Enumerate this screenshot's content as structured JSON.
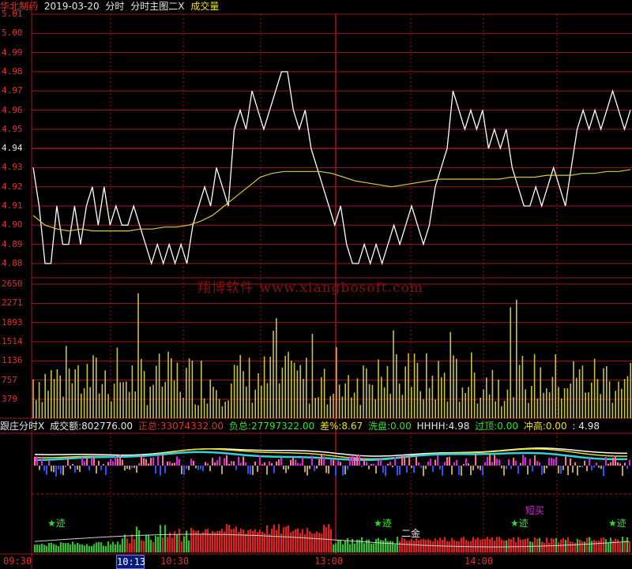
{
  "header": {
    "stock_name": "华北制药",
    "date": "2019-03-20",
    "period": "分时",
    "main_indicator": "分时主图二X",
    "volume_label": "成交量"
  },
  "indicator_bar": {
    "name": "跟庄分时X",
    "turnover_label": "成交额:",
    "turnover_value": "802776.00",
    "positive_label": "正总:",
    "positive_value": "33074332.00",
    "negative_label": "负总:",
    "negative_value": "27797322.00",
    "diff_label": "差%:",
    "diff_value": "8.67",
    "wash_label": "洗盘:",
    "wash_value": "0.00",
    "hhhh_label": "HHHH:",
    "hhhh_value": "4.98",
    "top_label": "过顶:",
    "top_value": "0.00",
    "rush_label": "冲高:",
    "rush_value": "0.00",
    "last_value": ": 4.98"
  },
  "price_axis": [
    "5.01",
    "5.00",
    "4.99",
    "4.98",
    "4.97",
    "4.96",
    "4.95",
    "4.94",
    "4.93",
    "4.92",
    "4.91",
    "4.90",
    "4.89",
    "4.88"
  ],
  "volume_axis": [
    "2650",
    "2271",
    "1893",
    "1514",
    "1136",
    "757",
    "379"
  ],
  "time_axis": [
    "09:30",
    "10:30",
    "13:00",
    "14:00"
  ],
  "selected_time": "10:13",
  "watermark": "翔博软件 www.xiangbosoft.com",
  "signals": {
    "trace_label": "★迹",
    "golden_label": "二金",
    "short_buy_label": "短买"
  },
  "colors": {
    "background": "#000000",
    "grid": "#a01818",
    "price_line": "#ffffff",
    "avg_line": "#d8c840",
    "volume_bar": "#c8c040",
    "up_bar": "#e02020",
    "down_bar": "#30c030",
    "label_red": "#e03030",
    "label_green": "#30e030",
    "label_yellow": "#e8e020"
  },
  "chart_data": {
    "type": "line",
    "title": "华北制药 2019-03-20 分时",
    "ylim": [
      4.88,
      5.01
    ],
    "x_ticks": [
      "09:30",
      "10:30",
      "13:00",
      "14:00"
    ],
    "series": [
      {
        "name": "price",
        "values": [
          4.93,
          4.91,
          4.88,
          4.88,
          4.91,
          4.89,
          4.89,
          4.91,
          4.89,
          4.91,
          4.92,
          4.9,
          4.92,
          4.9,
          4.91,
          4.9,
          4.9,
          4.91,
          4.9,
          4.89,
          4.88,
          4.89,
          4.88,
          4.89,
          4.88,
          4.89,
          4.88,
          4.9,
          4.91,
          4.92,
          4.91,
          4.93,
          4.92,
          4.91,
          4.95,
          4.96,
          4.95,
          4.97,
          4.96,
          4.95,
          4.96,
          4.97,
          4.98,
          4.98,
          4.96,
          4.95,
          4.96,
          4.94,
          4.93,
          4.92,
          4.91,
          4.9,
          4.91,
          4.89,
          4.88,
          4.88,
          4.89,
          4.88,
          4.89,
          4.88,
          4.89,
          4.9,
          4.89,
          4.9,
          4.91,
          4.9,
          4.89,
          4.9,
          4.92,
          4.93,
          4.94,
          4.97,
          4.96,
          4.95,
          4.96,
          4.95,
          4.96,
          4.94,
          4.95,
          4.94,
          4.95,
          4.93,
          4.92,
          4.91,
          4.91,
          4.92,
          4.91,
          4.92,
          4.93,
          4.92,
          4.91,
          4.93,
          4.95,
          4.96,
          4.95,
          4.96,
          4.95,
          4.96,
          4.97,
          4.96,
          4.95,
          4.96
        ]
      },
      {
        "name": "average",
        "values": [
          4.905,
          4.9,
          4.898,
          4.897,
          4.898,
          4.897,
          4.897,
          4.897,
          4.897,
          4.898,
          4.898,
          4.899,
          4.899,
          4.9,
          4.902,
          4.905,
          4.91,
          4.915,
          4.92,
          4.925,
          4.927,
          4.928,
          4.928,
          4.928,
          4.928,
          4.927,
          4.925,
          4.923,
          4.922,
          4.921,
          4.92,
          4.921,
          4.922,
          4.923,
          4.924,
          4.924,
          4.924,
          4.924,
          4.924,
          4.924,
          4.925,
          4.925,
          4.925,
          4.926,
          4.926,
          4.926,
          4.927,
          4.927,
          4.928,
          4.928,
          4.929
        ]
      }
    ]
  }
}
